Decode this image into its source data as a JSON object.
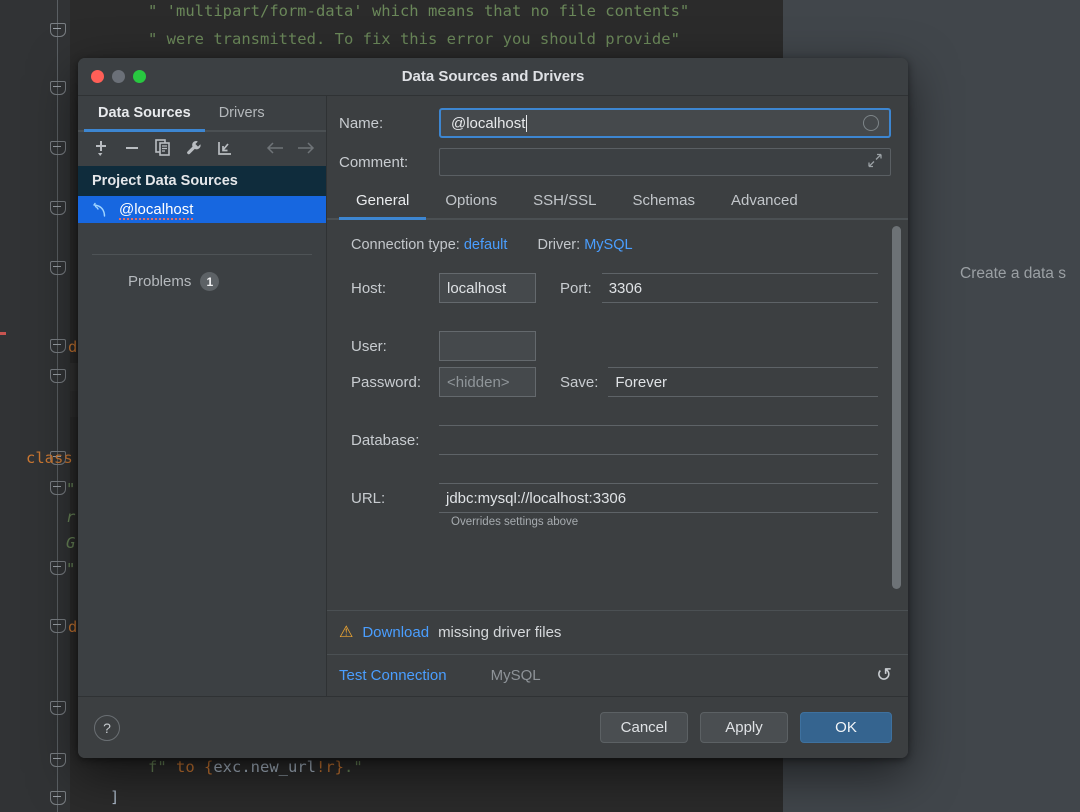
{
  "background": {
    "code_lines": [
      "\" 'multipart/form-data' which means that no file contents\"",
      "\" were transmitted. To fix this error you should provide\"",
      "d",
      "class",
      "\"",
      "r",
      "G",
      "\"",
      "d",
      "f\" to {exc.new_url!r}.\"",
      "]"
    ],
    "side_hint": "Create a data s"
  },
  "dialog": {
    "title": "Data Sources and Drivers",
    "window_controls": [
      "close",
      "minimize",
      "zoom"
    ]
  },
  "left_panel": {
    "tabs": [
      {
        "label": "Data Sources",
        "active": true
      },
      {
        "label": "Drivers",
        "active": false
      }
    ],
    "toolbar": [
      {
        "name": "add-icon",
        "glyph": "+"
      },
      {
        "name": "remove-icon",
        "glyph": "−"
      },
      {
        "name": "duplicate-icon",
        "glyph": "⧉"
      },
      {
        "name": "properties-icon",
        "glyph": "🔧"
      },
      {
        "name": "import-icon",
        "glyph": "↲"
      },
      {
        "name": "back-arrow-icon",
        "glyph": "←"
      },
      {
        "name": "forward-arrow-icon",
        "glyph": "→"
      }
    ],
    "section_header": "Project Data Sources",
    "items": [
      {
        "label": "@localhost",
        "icon": "mysql-dolphin-icon",
        "selected": true
      }
    ],
    "problems_label": "Problems",
    "problems_count": "1"
  },
  "form": {
    "name_label": "Name:",
    "name_value": "@localhost",
    "comment_label": "Comment:",
    "comment_value": "",
    "tabs": [
      {
        "label": "General",
        "active": true
      },
      {
        "label": "Options",
        "active": false
      },
      {
        "label": "SSH/SSL",
        "active": false
      },
      {
        "label": "Schemas",
        "active": false
      },
      {
        "label": "Advanced",
        "active": false
      }
    ],
    "connection_type_label": "Connection type:",
    "connection_type_value": "default",
    "driver_label": "Driver:",
    "driver_value": "MySQL",
    "host_label": "Host:",
    "host_value": "localhost",
    "port_label": "Port:",
    "port_value": "3306",
    "user_label": "User:",
    "user_value": "",
    "password_label": "Password:",
    "password_placeholder": "<hidden>",
    "save_label": "Save:",
    "save_value": "Forever",
    "database_label": "Database:",
    "database_value": "",
    "url_label": "URL:",
    "url_value": "jdbc:mysql://localhost:3306",
    "url_hint": "Overrides settings above"
  },
  "driver_bar": {
    "download_link": "Download",
    "download_rest": "missing driver files"
  },
  "test_bar": {
    "test_connection": "Test Connection",
    "driver_name": "MySQL",
    "revert_icon": "↺"
  },
  "footer": {
    "help": "?",
    "cancel": "Cancel",
    "apply": "Apply",
    "ok": "OK"
  },
  "colors": {
    "accent_blue": "#3d86d1",
    "link_blue": "#4a9eff",
    "selection_blue": "#1767e0",
    "ok_button": "#35648f",
    "warning_orange": "#f0a732",
    "dialog_bg": "#3c3f41",
    "panel_bg": "#3c4043",
    "section_header_bg": "#0f2c3c"
  }
}
